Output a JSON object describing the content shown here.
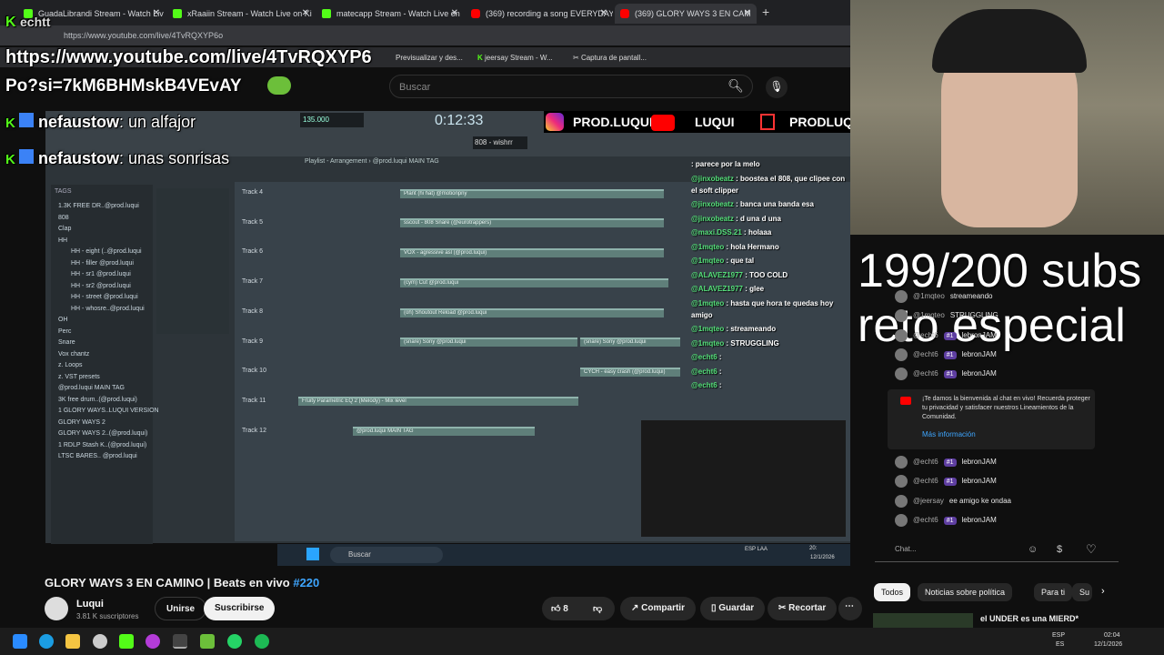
{
  "browser": {
    "tabs": [
      {
        "label": "GuadaLibrandi Stream - Watch Liv",
        "color": "#53fc18"
      },
      {
        "label": "xRaaiin Stream - Watch Live on Ki",
        "color": "#53fc18"
      },
      {
        "label": "matecapp Stream - Watch Live on",
        "color": "#53fc18"
      },
      {
        "label": "(369) recording a song EVERYDAY",
        "color": "#ff0000"
      },
      {
        "label": "(369) GLORY WAYS 3 EN CAM",
        "color": "#ff0000"
      }
    ],
    "url": "https://www.youtube.com/live/4TvRQXYP6o",
    "bookmarks": [
      "Previsualizar y des...",
      "jeersay Stream - W...",
      "Captura de pantall..."
    ]
  },
  "youtube": {
    "search_placeholder": "Buscar",
    "video_title": "GLORY WAYS 3 EN CAMINO | Beats en vivo ",
    "hashtag": "#220",
    "channel_name": "Luqui",
    "subscribers": "3.81 K suscriptores",
    "join_label": "Unirse",
    "subscribe_label": "Suscribirse",
    "likes": "8",
    "share_label": "Compartir",
    "save_label": "Guardar",
    "clip_label": "Recortar"
  },
  "overlay": {
    "url_line1": "https://www.youtube.com/live/4TvRQXYP6",
    "url_line2": "Po?si=7kM6BHMskB4VEvAY",
    "msg1_user": "nefaustow",
    "msg1_text": ": un alfajor",
    "msg2_user": "nefaustow",
    "msg2_text": ": unas sonrisas",
    "kick_handle": "echtt",
    "brand1": "PROD.LUQUI",
    "brand2": "LUQUI",
    "brand3": "PRODLUQUI",
    "subs_goal_line1": "199/200 subs",
    "subs_goal_line2": "reto especial"
  },
  "fl_studio": {
    "time": "0:12:33",
    "tempo": "135.000",
    "pattern": "808 - wishrr",
    "playlist_title": "Playlist - Arrangement › @prod.luqui MAIN TAG",
    "browser_tag": "TAGS",
    "browser_items": [
      "1.3K FREE DR..@prod.luqui",
      "808",
      "Clap",
      "HH",
      "HH - eight (..@prod.luqui",
      "HH - filler @prod.luqui",
      "HH - sr1 @prod.luqui",
      "HH - sr2 @prod.luqui",
      "HH - street @prod.luqui",
      "HH - whosre..@prod.luqui",
      "OH",
      "Perc",
      "Snare",
      "Vox chantz",
      "z. Loops",
      "z. VST presets",
      "@prod.luqui MAIN TAG",
      "3K free drum..(@prod.luqui)",
      "1 GLORY WAYS..LUQUI VERSION",
      "GLORY WAYS 2",
      "GLORY WAYS 2..(@prod.luqui)",
      "1 RDLP Stash K..(@prod.luqui)",
      "LTSC BARES.. @prod.luqui"
    ],
    "tracks": [
      "Track 4",
      "Track 5",
      "Track 6",
      "Track 7",
      "Track 8",
      "Track 9",
      "Track 10",
      "Track 11",
      "Track 12"
    ],
    "clips": [
      "Plant (hi hat) @motionpny",
      "sscout - 808 Snare (@eurotrappers)",
      "VOX - agressive asl (@prod.luqui)",
      "(cym) Cut @prod.luqui",
      "(oh) Shoutout Reload @prod.luqui",
      "(snare) Sony @prod.luqui",
      "(snare) Sony @prod.luqui",
      "CYCH - easy crash (@prod.luqui)",
      "Fruity Parametric EQ 2 (Melody) - Mix level",
      "@prod.luqui MAIN TAG"
    ],
    "overlay_chat": [
      {
        "user": "",
        "text": ": parece por la melo"
      },
      {
        "user": "@jinxobeatz",
        "text": ": boostea el 808, que clipee con el soft clipper"
      },
      {
        "user": "@jinxobeatz",
        "text": ": banca una banda esa"
      },
      {
        "user": "@jinxobeatz",
        "text": ": d una d una"
      },
      {
        "user": "@maxi.DSS.21",
        "text": ": holaaa"
      },
      {
        "user": "@1mqteo",
        "text": ": hola Hermano"
      },
      {
        "user": "@1mqteo",
        "text": ": que tal"
      },
      {
        "user": "@ALAVEZ1977",
        "text": ": TOO COLD"
      },
      {
        "user": "@ALAVEZ1977",
        "text": ": glee"
      },
      {
        "user": "@1mqteo",
        "text": ": hasta que hora te quedas hoy amigo"
      },
      {
        "user": "@1mqteo",
        "text": ": streameando"
      },
      {
        "user": "@1mqteo",
        "text": ": STRUGGLING"
      },
      {
        "user": "@echt6",
        "text": ":"
      },
      {
        "user": "@echt6",
        "text": ":"
      },
      {
        "user": "@echt6",
        "text": ":"
      }
    ],
    "inner_taskbar_search": "Buscar",
    "inner_clock_time": "20:",
    "inner_clock_date": "12/1/2026",
    "inner_lang": "ESP LAA"
  },
  "live_chat": {
    "messages": [
      {
        "name": "@1mqteo",
        "text": "streameando",
        "badge": ""
      },
      {
        "name": "@1mqteo",
        "text": "STRUGGLING",
        "badge": ""
      },
      {
        "name": "@echt6",
        "text": "lebronJAM",
        "badge": "#1"
      },
      {
        "name": "@echt6",
        "text": "lebronJAM",
        "badge": "#1"
      },
      {
        "name": "@echt6",
        "text": "lebronJAM",
        "badge": "#1"
      }
    ],
    "welcome": "¡Te damos la bienvenida al chat en vivo! Recuerda proteger tu privacidad y satisfacer nuestros Lineamientos de la Comunidad.",
    "learn_more": "Más información",
    "messages2": [
      {
        "name": "@echt6",
        "text": "lebronJAM",
        "badge": "#1"
      },
      {
        "name": "@echt6",
        "text": "lebronJAM",
        "badge": "#1"
      },
      {
        "name": "@jeersay",
        "text": "ee amigo ke ondaa",
        "badge": ""
      },
      {
        "name": "@echt6",
        "text": "lebronJAM",
        "badge": "#1"
      }
    ],
    "input_placeholder": "Chat..."
  },
  "chips": [
    "Todos",
    "Noticias sobre política",
    "Para ti",
    "Su"
  ],
  "next_video": "el UNDER es una MIERD*",
  "taskbar": {
    "lang": "ESP",
    "lang2": "ES",
    "time": "02:04",
    "date": "12/1/2026"
  }
}
